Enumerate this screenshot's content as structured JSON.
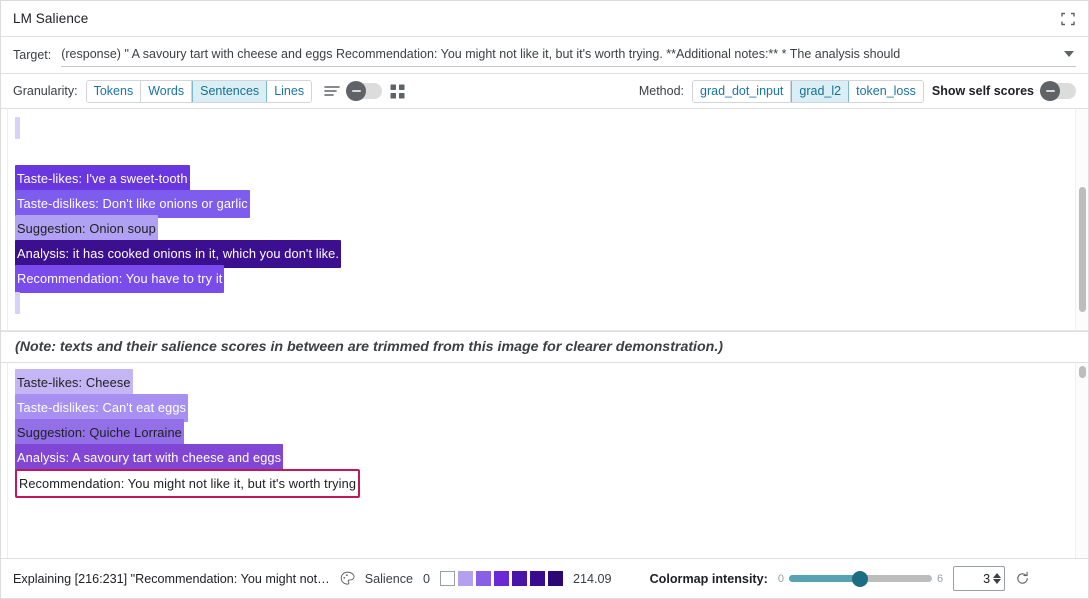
{
  "window": {
    "title": "LM Salience",
    "expand_icon": "fullscreen-icon"
  },
  "target": {
    "label": "Target:",
    "value": "(response) \" A savoury tart with cheese and eggs Recommendation: You might not like it, but it's worth trying. **Additional notes:** * The analysis should",
    "caret_icon": "chevron-down-icon"
  },
  "controls": {
    "granularity_label": "Granularity:",
    "granularity_options": [
      "Tokens",
      "Words",
      "Sentences",
      "Lines"
    ],
    "granularity_selected": "Sentences",
    "lines_icon": "lines-view-icon",
    "grid_icon": "grid-view-icon",
    "display_toggle_state": "off",
    "method_label": "Method:",
    "method_options": [
      "grad_dot_input",
      "grad_l2",
      "token_loss"
    ],
    "method_selected": "grad_l2",
    "self_scores_label": "Show self scores",
    "self_scores_toggle_state": "off"
  },
  "panel_top": {
    "lines": [
      {
        "text": "",
        "blank": true,
        "color": "#d6d1fa",
        "light": true
      },
      {
        "text": "",
        "blank": true,
        "empty": true
      },
      {
        "text": "Taste-likes: I've a sweet-tooth",
        "color": "#6837df",
        "light": false
      },
      {
        "text": "Taste-dislikes: Don't like onions or garlic",
        "color": "#7d5cee",
        "light": false
      },
      {
        "text": "Suggestion: Onion soup",
        "color": "#b0a1f3",
        "light": true
      },
      {
        "text": "Analysis: it has cooked onions in it, which you don't like.",
        "color": "#3b0f8f",
        "light": false
      },
      {
        "text": "Recommendation: You have to try it",
        "color": "#7a4ceb",
        "light": false
      },
      {
        "text": "",
        "blank": true,
        "color": "#d6d1fa",
        "light": true
      }
    ]
  },
  "note": {
    "text": "(Note: texts and their salience scores in between are trimmed from this image for clearer demonstration.)"
  },
  "panel_bottom": {
    "lines": [
      {
        "text": "Taste-likes: Cheese",
        "color": "#c4b5f5",
        "light": true
      },
      {
        "text": "Taste-dislikes: Can't eat eggs",
        "color": "#a790f2",
        "light": false
      },
      {
        "text": "Suggestion: Quiche Lorraine",
        "color": "#9370e8",
        "light": true
      },
      {
        "text": "Analysis: A savoury tart with cheese and eggs",
        "color": "#8246d4",
        "light": false
      },
      {
        "text": "Recommendation: You might not like it, but it's worth trying",
        "selected": true
      }
    ]
  },
  "status": {
    "explaining_text": "Explaining [216:231] \"Recommendation: You might not…",
    "palette_icon": "palette-icon",
    "salience_label": "Salience",
    "legend_min": "0",
    "legend_max": "214.09",
    "legend_swatches": [
      "#ffffff",
      "#b3a1ef",
      "#8a5fe8",
      "#6b28d6",
      "#4a14a8",
      "#3a0b8f",
      "#2c0775"
    ],
    "colormap_label": "Colormap intensity:",
    "slider_min": "0",
    "slider_max": "6",
    "slider_value": 3,
    "number_value": "3",
    "reset_icon": "reset-icon"
  }
}
